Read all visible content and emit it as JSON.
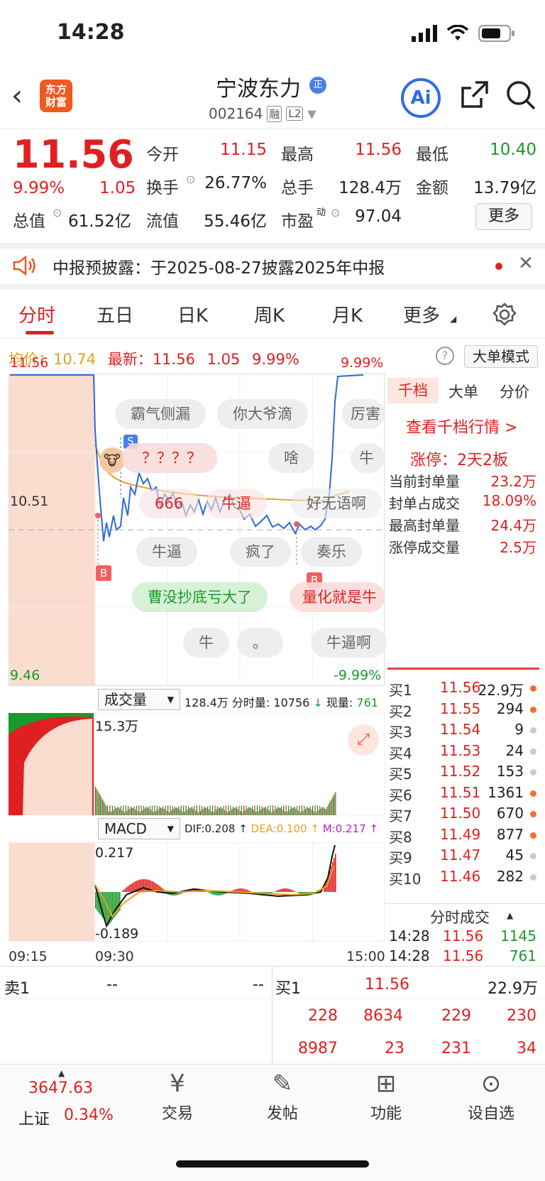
{
  "status_bar": {
    "time": "14:28"
  },
  "header": {
    "logo_line1": "东方",
    "logo_line2": "财富",
    "stock_name": "宁波东力",
    "verified_badge": "正",
    "stock_code": "002164",
    "tag_margin": "融",
    "tag_level": "L2",
    "ai_label": "Ai"
  },
  "quote": {
    "price": "11.56",
    "pct": "9.99%",
    "change": "1.05",
    "open_label": "今开",
    "open": "11.15",
    "high_label": "最高",
    "high": "11.56",
    "low_label": "最低",
    "low": "10.40",
    "turnover_label": "换手",
    "turnover": "26.77%",
    "volume_label": "总手",
    "volume": "128.4万",
    "amount_label": "金额",
    "amount": "13.79亿",
    "mcap_label": "总值",
    "mcap": "61.52亿",
    "float_label": "流值",
    "float": "55.46亿",
    "pe_label": "市盈",
    "pe_sup": "动",
    "pe": "97.04",
    "more": "更多"
  },
  "notice": {
    "text": "中报预披露：于2025-08-27披露2025年中报"
  },
  "tabs": [
    "分时",
    "五日",
    "日K",
    "周K",
    "月K",
    "更多"
  ],
  "avg": {
    "avg_label": "均价：",
    "avg_value": "10.74",
    "latest_label": "最新：",
    "latest": "11.56",
    "latest_change": "1.05",
    "latest_pct": "9.99%",
    "help": "?",
    "big_mode": "大单模式"
  },
  "chart": {
    "top_price": "11.56",
    "mid_price": "10.51",
    "bottom_price": "9.46",
    "top_pct": "9.99%",
    "bottom_pct": "-9.99%",
    "s_mark": "S",
    "b_mark": "B",
    "danmu": [
      "霸气侧漏",
      "你大爷滴",
      "厉害",
      "？？？？",
      "啥",
      "牛",
      "666",
      "牛逼",
      "好无语啊",
      "牛逼",
      "疯了",
      "奏乐",
      "曹没抄底亏大了",
      "量化就是牛",
      "牛",
      "。",
      "牛逼啊"
    ]
  },
  "volume_panel": {
    "select": "成交量",
    "total": "128.4万",
    "minute_label": "分时量:",
    "minute_value": "10756",
    "now_label": "现量:",
    "now_value": "761",
    "max": "15.3万"
  },
  "macd_panel": {
    "select": "MACD",
    "dif": "DIF:0.208 ↑",
    "dea": "DEA:0.100 ↑",
    "m": "M:0.217 ↑",
    "top": "0.217",
    "bottom": "-0.189"
  },
  "time_axis": [
    "09:15",
    "09:30",
    "15:00"
  ],
  "right_panel": {
    "tabs": [
      "千档",
      "大单",
      "分价"
    ],
    "link": "查看千档行情 >",
    "limit_info": "涨停：2天2板",
    "rows": [
      {
        "label": "当前封单量",
        "value": "23.2万"
      },
      {
        "label": "封单占成交",
        "value": "18.09%"
      },
      {
        "label": "最高封单量",
        "value": "24.4万"
      },
      {
        "label": "涨停成交量",
        "value": "2.5万"
      }
    ],
    "bids": [
      {
        "label": "买1",
        "price": "11.56",
        "vol": "22.9万",
        "dot": "#f07030"
      },
      {
        "label": "买2",
        "price": "11.55",
        "vol": "294",
        "dot": "#f07030"
      },
      {
        "label": "买3",
        "price": "11.54",
        "vol": "9",
        "dot": "#cccccc"
      },
      {
        "label": "买4",
        "price": "11.53",
        "vol": "24",
        "dot": "#cccccc"
      },
      {
        "label": "买5",
        "price": "11.52",
        "vol": "153",
        "dot": "#cccccc"
      },
      {
        "label": "买6",
        "price": "11.51",
        "vol": "1361",
        "dot": "#f07030"
      },
      {
        "label": "买7",
        "price": "11.50",
        "vol": "670",
        "dot": "#f07030"
      },
      {
        "label": "买8",
        "price": "11.49",
        "vol": "877",
        "dot": "#f07030"
      },
      {
        "label": "买9",
        "price": "11.47",
        "vol": "45",
        "dot": "#cccccc"
      },
      {
        "label": "买10",
        "price": "11.46",
        "vol": "282",
        "dot": "#cccccc"
      }
    ],
    "ticks_title": "分时成交",
    "ticks": [
      {
        "time": "14:28",
        "price": "11.56",
        "vol": "1145"
      },
      {
        "time": "14:28",
        "price": "11.56",
        "vol": "761"
      }
    ]
  },
  "orderbook": {
    "sell_label": "卖1",
    "sell_price": "--",
    "sell_vol": "--",
    "buy_label": "买1",
    "buy_price": "11.56",
    "buy_vol": "22.9万",
    "queue_row1": [
      "228",
      "8634",
      "229",
      "230"
    ],
    "queue_row2": [
      "8987",
      "23",
      "231",
      "34"
    ]
  },
  "bottom_nav": {
    "index_value": "3647.63",
    "index_name": "上证",
    "index_pct": "0.34%",
    "items": [
      {
        "label": "交易",
        "icon": "trade-icon"
      },
      {
        "label": "发帖",
        "icon": "post-icon"
      },
      {
        "label": "功能",
        "icon": "function-icon"
      },
      {
        "label": "设自选",
        "icon": "add-watchlist-icon"
      }
    ]
  }
}
